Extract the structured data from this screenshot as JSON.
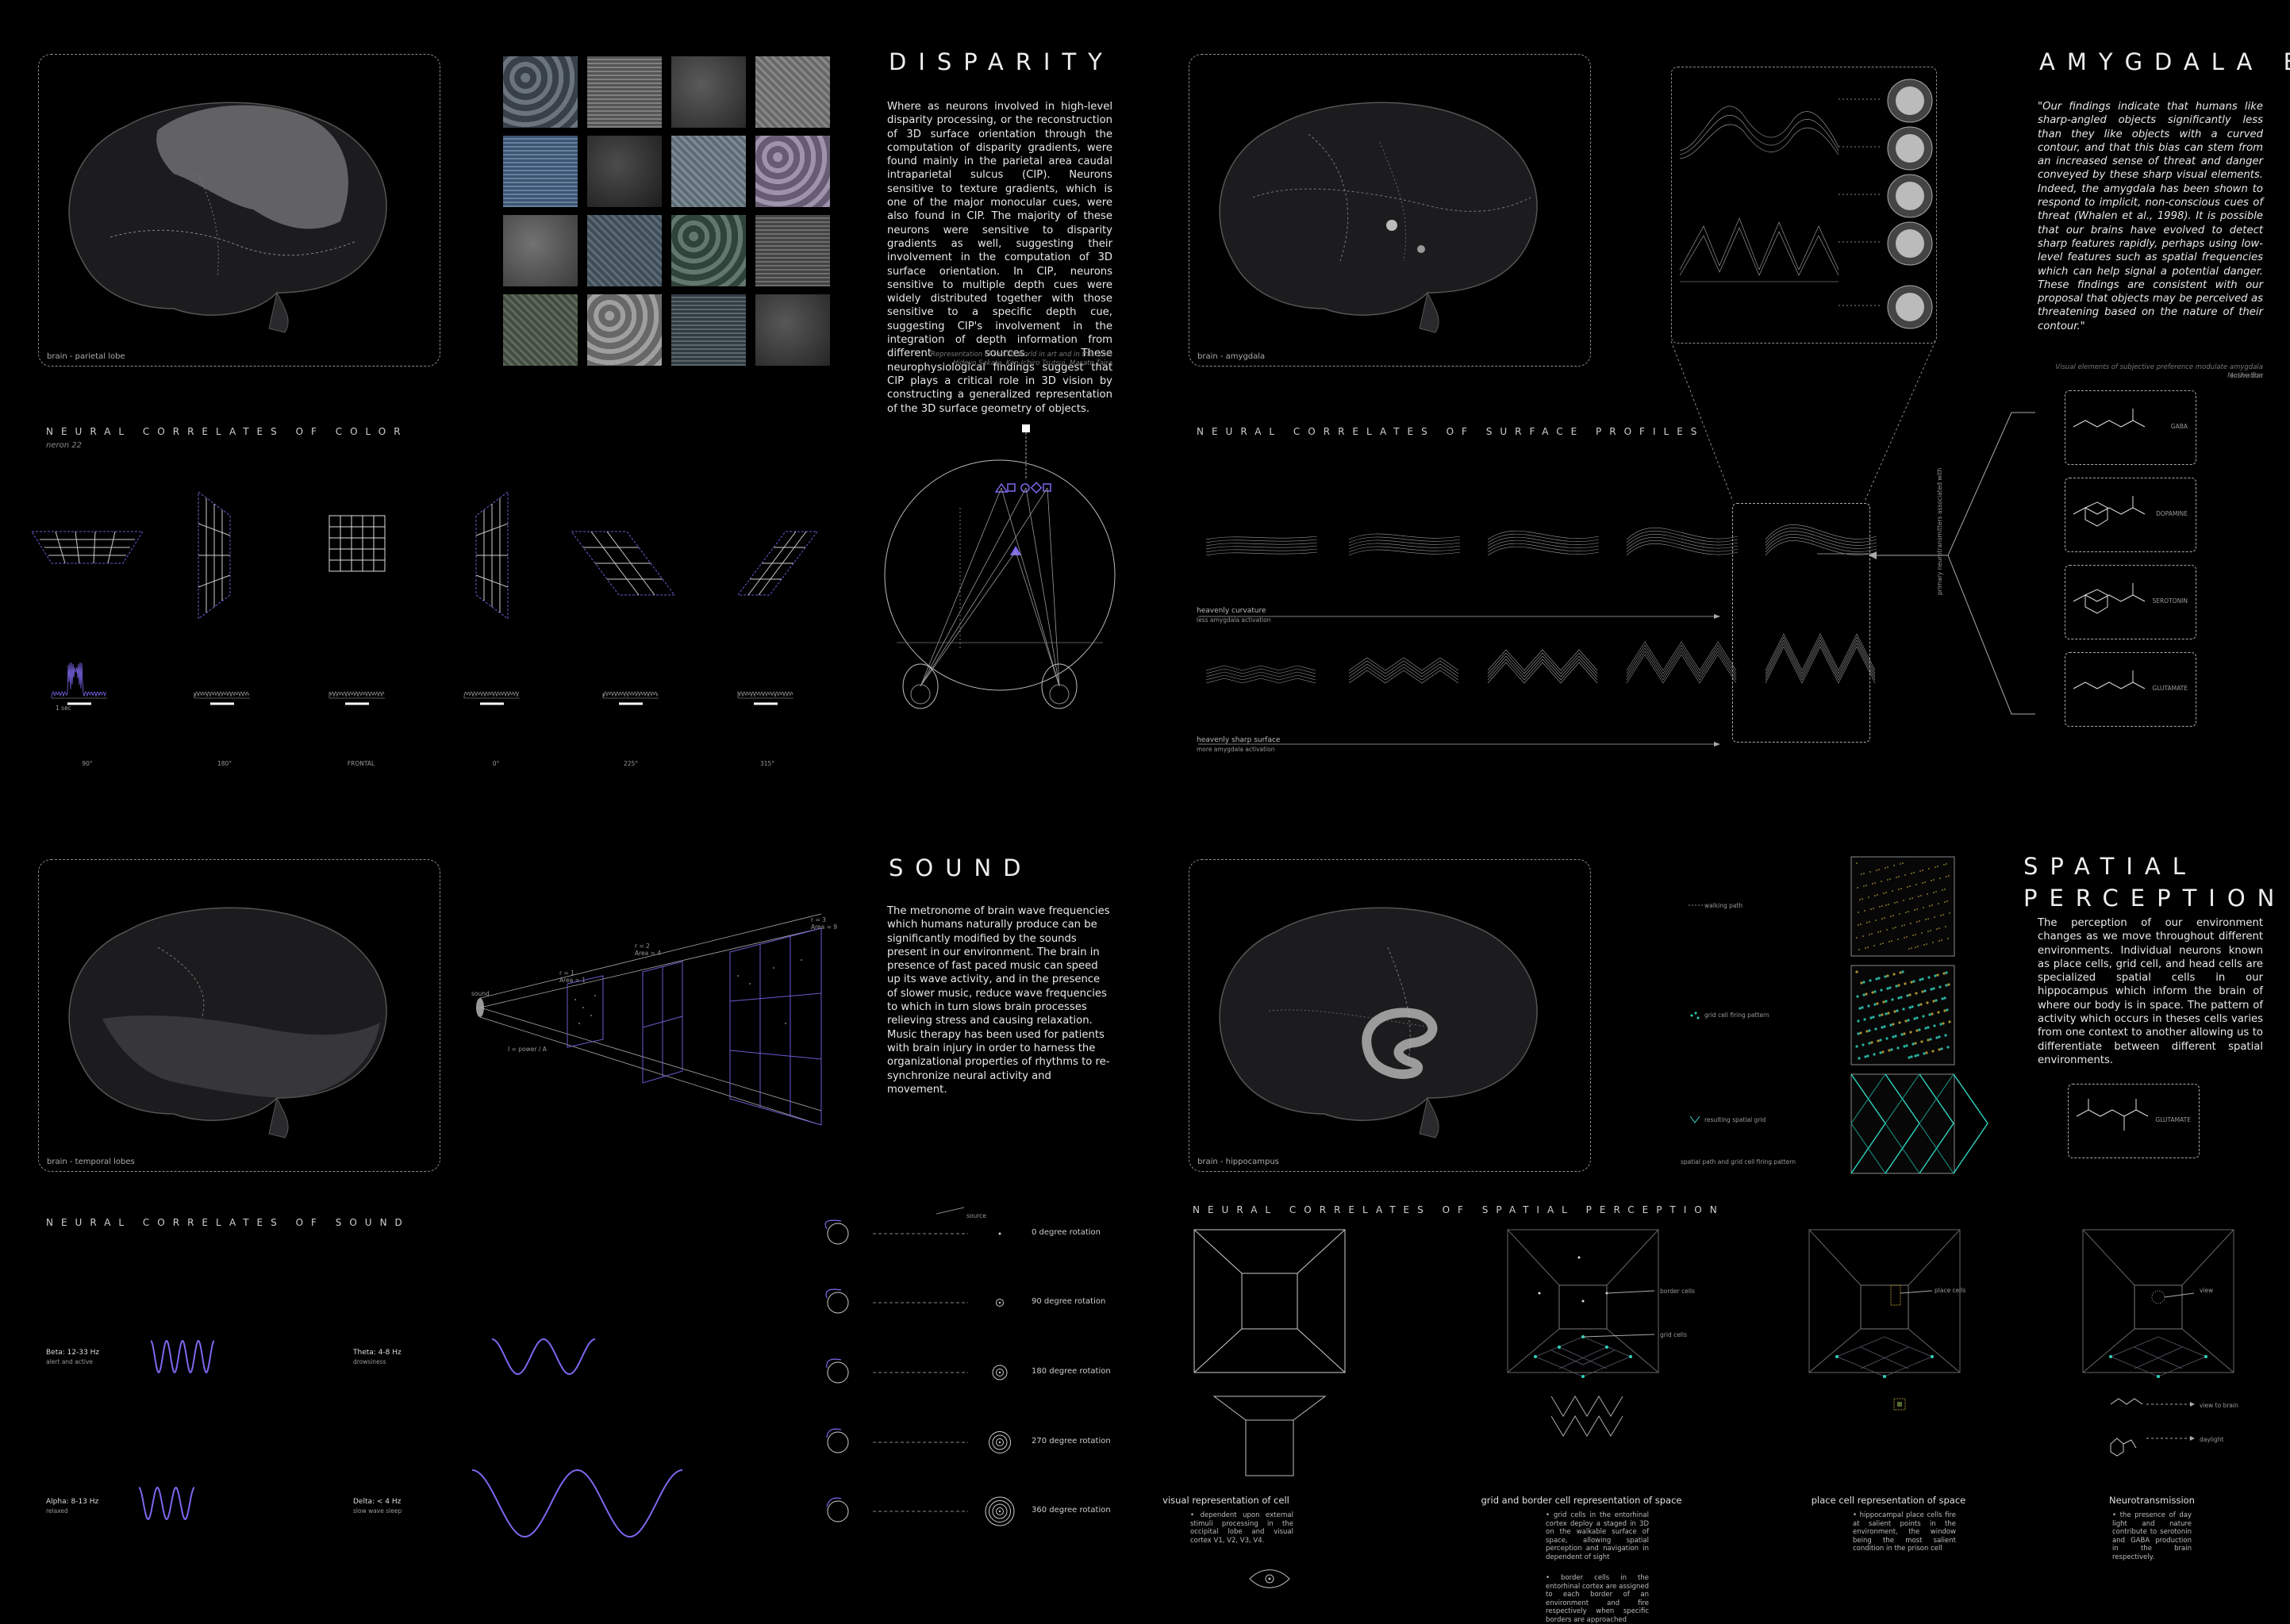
{
  "disparity": {
    "title": "DISPARITY",
    "body": "Where as neurons involved in high-level disparity processing, or the reconstruction of 3D surface orientation through the computation of disparity gradients, were found mainly in the parietal area caudal intraparietal sulcus (CIP). Neurons sensitive to texture gradients, which is one of the major monocular cues, were also found in CIP. The majority of these neurons were sensitive to disparity gradients as well, suggesting their involvement in the computation of 3D surface orientation. In CIP, neurons sensitive to multiple depth cues were widely distributed together with those sensitive to a specific depth cue, suggesting CIP's involvement in the integration of depth information from different sources. These neurophysiological findings suggest that CIP plays a critical role in 3D vision by constructing a generalized representation of the 3D surface geometry of objects.",
    "source_line1": "Representation of the 3D world in art and in the brain",
    "source_line2": "Hideyo Sakata, Ken-Ichiro Tsutsui, Masato Taira",
    "brain_caption": "brain - parietal lobe",
    "texture_colors": [
      "#4a5560",
      "#6a6a6a",
      "#3e3e3e",
      "#7a7a7a",
      "#4d6a8f",
      "#2d2d2d",
      "#6d7e88",
      "#8a7a9a",
      "#5a5a5a",
      "#4a5a66",
      "#3f5a4f",
      "#555555",
      "#4d5a4a",
      "#8a8a8a",
      "#3e4a52",
      "#3a3a3a"
    ]
  },
  "color": {
    "section": "NEURAL CORRELATES OF COLOR",
    "sub": "neron 22",
    "angles": [
      "90°",
      "180°",
      "FRONTAL",
      "0°",
      "225°",
      "315°"
    ],
    "spike_label": "1 sec"
  },
  "amygdala": {
    "title": "AMYGDALA BIAS",
    "quote": "\"Our findings indicate that humans like sharp-angled objects significantly less than they like objects with a curved contour, and that this bias can stem from an increased sense of threat and danger conveyed by these sharp visual elements. Indeed, the amygdala has been shown to respond to implicit, non-conscious cues of threat (Whalen et al., 1998). It is possible that our brains have evolved to detect sharp features rapidly, perhaps using low-level features such as spatial frequencies which can help signal a potential danger. These findings are consistent with our proposal that objects may be perceived as threatening based on the nature of their contour.\"",
    "source_line1": "Visual elements of subjective preference modulate amygdala activation",
    "source_line2": "Moshe Bar",
    "brain_caption": "brain - amygdala"
  },
  "surface": {
    "section": "NEURAL CORRELATES OF SURFACE PROFILES",
    "row1_label": "heavenly curvature",
    "row1_sub": "less amygdala activation",
    "row2_label": "heavenly sharp surface",
    "row2_sub": "more amygdala activation",
    "vertical_label": "primary neurotransmitters associated with",
    "molecules": [
      "GABA",
      "DOPAMINE",
      "SEROTONIN",
      "GLUTAMATE"
    ]
  },
  "sound": {
    "title": "SOUND",
    "body": "The metronome of brain wave frequencies which humans naturally produce can be significantly modified by the sounds present in our environment. The brain in presence of fast paced music can speed up its wave activity, and in the presence of slower music, reduce wave frequencies to which in turn slows brain processes relieving stress and causing relaxation. Music therapy has been used for patients with brain injury in order to harness the organizational properties of rhythms to re-synchronize neural activity and movement.",
    "brain_caption": "brain - temporal lobes",
    "section": "NEURAL CORRELATES OF SOUND",
    "source_label": "sound",
    "frame_labels": [
      "r = 1\nArea = 1",
      "r = 2\nArea = 4",
      "r = 3\nArea = 9"
    ],
    "intensity": "I = power / A"
  },
  "waves": [
    {
      "name": "Beta: 12-33 Hz",
      "desc": "alert and active"
    },
    {
      "name": "Theta: 4-8 Hz",
      "desc": "drowsiness"
    },
    {
      "name": "Alpha: 8-13 Hz",
      "desc": "relaxed"
    },
    {
      "name": "Delta: < 4 Hz",
      "desc": "slow wave sleep"
    }
  ],
  "rotations": {
    "source": "source",
    "items": [
      "0 degree rotation",
      "90 degree rotation",
      "180 degree rotation",
      "270 degree rotation",
      "360 degree rotation"
    ]
  },
  "spatial": {
    "title_line1": "SPATIAL",
    "title_line2": "PERCEPTION",
    "body": "The perception of our environment changes as we move throughout different environments. Individual neurons known as place cells, grid cell, and head cells are specialized spatial cells in our hippocampus which inform the brain of where our body is in space. The pattern of activity which occurs in theses cells varies from one context to another allowing us to differentiate between different spatial environments.",
    "brain_caption": "brain - hippocampus",
    "legend": [
      "walking path",
      "grid cell firing pattern",
      "resulting spatial grid"
    ],
    "legend_caption": "spatial path and grid cell firing pattern",
    "section": "NEURAL CORRELATES OF SPATIAL PERCEPTION",
    "labels": {
      "border": "border cells",
      "grid": "grid cells",
      "place": "place cells",
      "view": "view",
      "view_to_brain": "view to brain",
      "daylight": "daylight",
      "molecule": "GLUTAMATE"
    },
    "columns": [
      {
        "title": "visual representation of cell",
        "bullets": [
          "dependent upon external stimuli processing in the occipital lobe and visual cortex V1, V2, V3, V4."
        ]
      },
      {
        "title": "grid and border cell representation of space",
        "bullets": [
          "grid cells in the entorhinal cortex deploy a staged in 3D on the walkable surface of space, allowing spatial perception and navigation in dependent of sight",
          "border cells in the entorhinal cortex are assigned to each border of an environment and fire respectively when specific borders are approached"
        ]
      },
      {
        "title": "place cell representation of space",
        "bullets": [
          "hippocampal place cells fire at salient points in the environment, the window being the most salient condition in the prison cell"
        ]
      },
      {
        "title": "Neurotransmission",
        "bullets": [
          "the presence of day light and nature contribute to serotonin and GABA production in the brain respectively."
        ]
      }
    ]
  }
}
